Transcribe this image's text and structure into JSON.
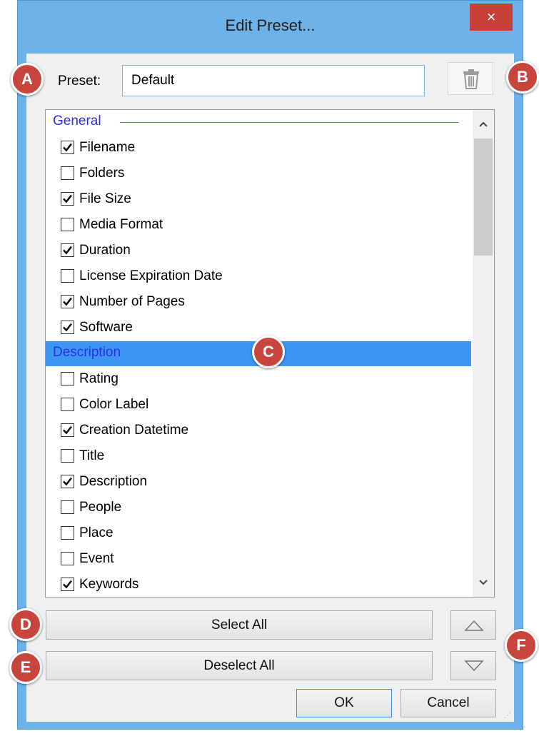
{
  "window": {
    "title": "Edit Preset...",
    "close_label": "×"
  },
  "preset": {
    "label": "Preset:",
    "value": "Default"
  },
  "icons": {
    "trash": "trash-icon",
    "up": "triangle-up-icon",
    "down": "triangle-down-icon"
  },
  "list": {
    "groups": [
      {
        "name": "General",
        "selected": false,
        "items": [
          {
            "label": "Filename",
            "checked": true
          },
          {
            "label": "Folders",
            "checked": false
          },
          {
            "label": "File Size",
            "checked": true
          },
          {
            "label": "Media Format",
            "checked": false
          },
          {
            "label": "Duration",
            "checked": true
          },
          {
            "label": "License Expiration Date",
            "checked": false
          },
          {
            "label": "Number of Pages",
            "checked": true
          },
          {
            "label": "Software",
            "checked": true
          }
        ]
      },
      {
        "name": "Description",
        "selected": true,
        "items": [
          {
            "label": "Rating",
            "checked": false
          },
          {
            "label": "Color Label",
            "checked": false
          },
          {
            "label": "Creation Datetime",
            "checked": true
          },
          {
            "label": "Title",
            "checked": false
          },
          {
            "label": "Description",
            "checked": true
          },
          {
            "label": "People",
            "checked": false
          },
          {
            "label": "Place",
            "checked": false
          },
          {
            "label": "Event",
            "checked": false
          },
          {
            "label": "Keywords",
            "checked": true
          }
        ]
      }
    ]
  },
  "buttons": {
    "select_all": "Select All",
    "deselect_all": "Deselect All",
    "ok": "OK",
    "cancel": "Cancel"
  },
  "markers": [
    "A",
    "B",
    "C",
    "D",
    "E",
    "F"
  ],
  "colors": {
    "accent": "#3c95f2",
    "marker": "#c8453e",
    "frame": "#6db2e8"
  }
}
